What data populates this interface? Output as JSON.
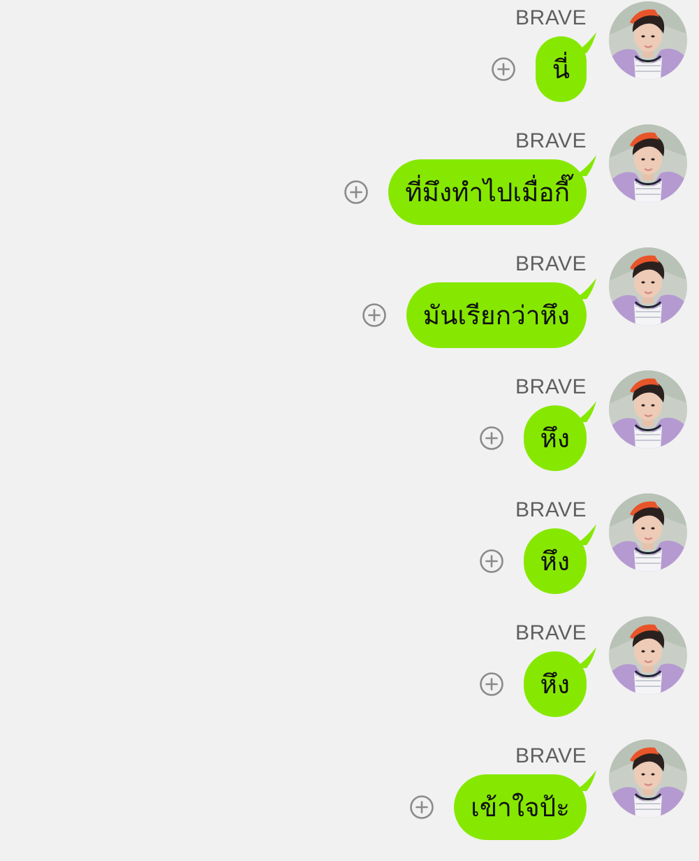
{
  "theme": {
    "background": "#f1f1f1",
    "bubble_color": "#86e800",
    "sender_color": "#5f5f5f",
    "icon_color": "#8a8a8a"
  },
  "messages": [
    {
      "sender": "BRAVE",
      "text": "นี่",
      "action_icon": "plus-circle-icon"
    },
    {
      "sender": "BRAVE",
      "text": "ที่มึงทำไปเมื่อกี๊",
      "action_icon": "plus-circle-icon"
    },
    {
      "sender": "BRAVE",
      "text": "มันเรียกว่าหึง",
      "action_icon": "plus-circle-icon"
    },
    {
      "sender": "BRAVE",
      "text": "หึง",
      "action_icon": "plus-circle-icon"
    },
    {
      "sender": "BRAVE",
      "text": "หึง",
      "action_icon": "plus-circle-icon"
    },
    {
      "sender": "BRAVE",
      "text": "หึง",
      "action_icon": "plus-circle-icon"
    },
    {
      "sender": "BRAVE",
      "text": "เข้าใจป้ะ",
      "action_icon": "plus-circle-icon"
    }
  ]
}
